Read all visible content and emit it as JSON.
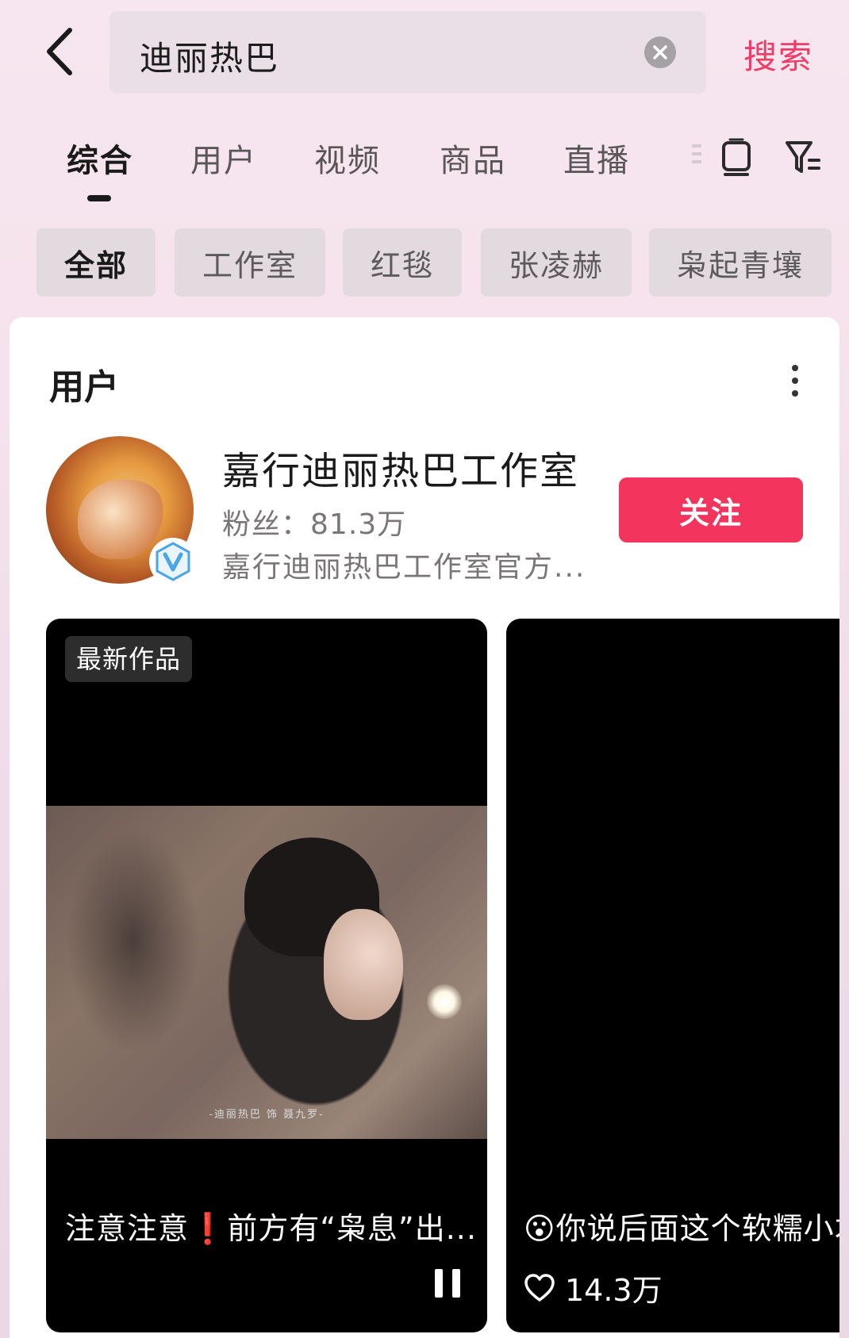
{
  "header": {
    "search_query": "迪丽热巴",
    "search_button": "搜索"
  },
  "tabs": [
    {
      "label": "综合",
      "active": true
    },
    {
      "label": "用户"
    },
    {
      "label": "视频"
    },
    {
      "label": "商品"
    },
    {
      "label": "直播"
    }
  ],
  "chips": [
    {
      "label": "全部",
      "active": true
    },
    {
      "label": "工作室"
    },
    {
      "label": "红毯"
    },
    {
      "label": "张凌赫"
    },
    {
      "label": "枭起青壤"
    }
  ],
  "section": {
    "title": "用户"
  },
  "user": {
    "name": "嘉行迪丽热巴工作室",
    "fans_label": "粉丝：",
    "fans_count": "81.3万",
    "description": "嘉行迪丽热巴工作室官方...",
    "follow_label": "关注"
  },
  "videos": [
    {
      "badge": "最新作品",
      "still_caption": "-迪丽热巴 饰 聂九罗-",
      "title": "注意注意❗前方有“枭息”出..."
    },
    {
      "title": "😮你说后面这个软糯小才",
      "likes": "14.3万"
    }
  ],
  "colors": {
    "accent": "#f03b67",
    "follow_button": "#f3355e",
    "verify_badge": "#4aa6e8"
  },
  "icons": [
    "back-arrow-icon",
    "clear-icon",
    "tablet-icon",
    "filter-icon",
    "more-icon",
    "verified-icon",
    "pause-icon",
    "heart-icon"
  ]
}
